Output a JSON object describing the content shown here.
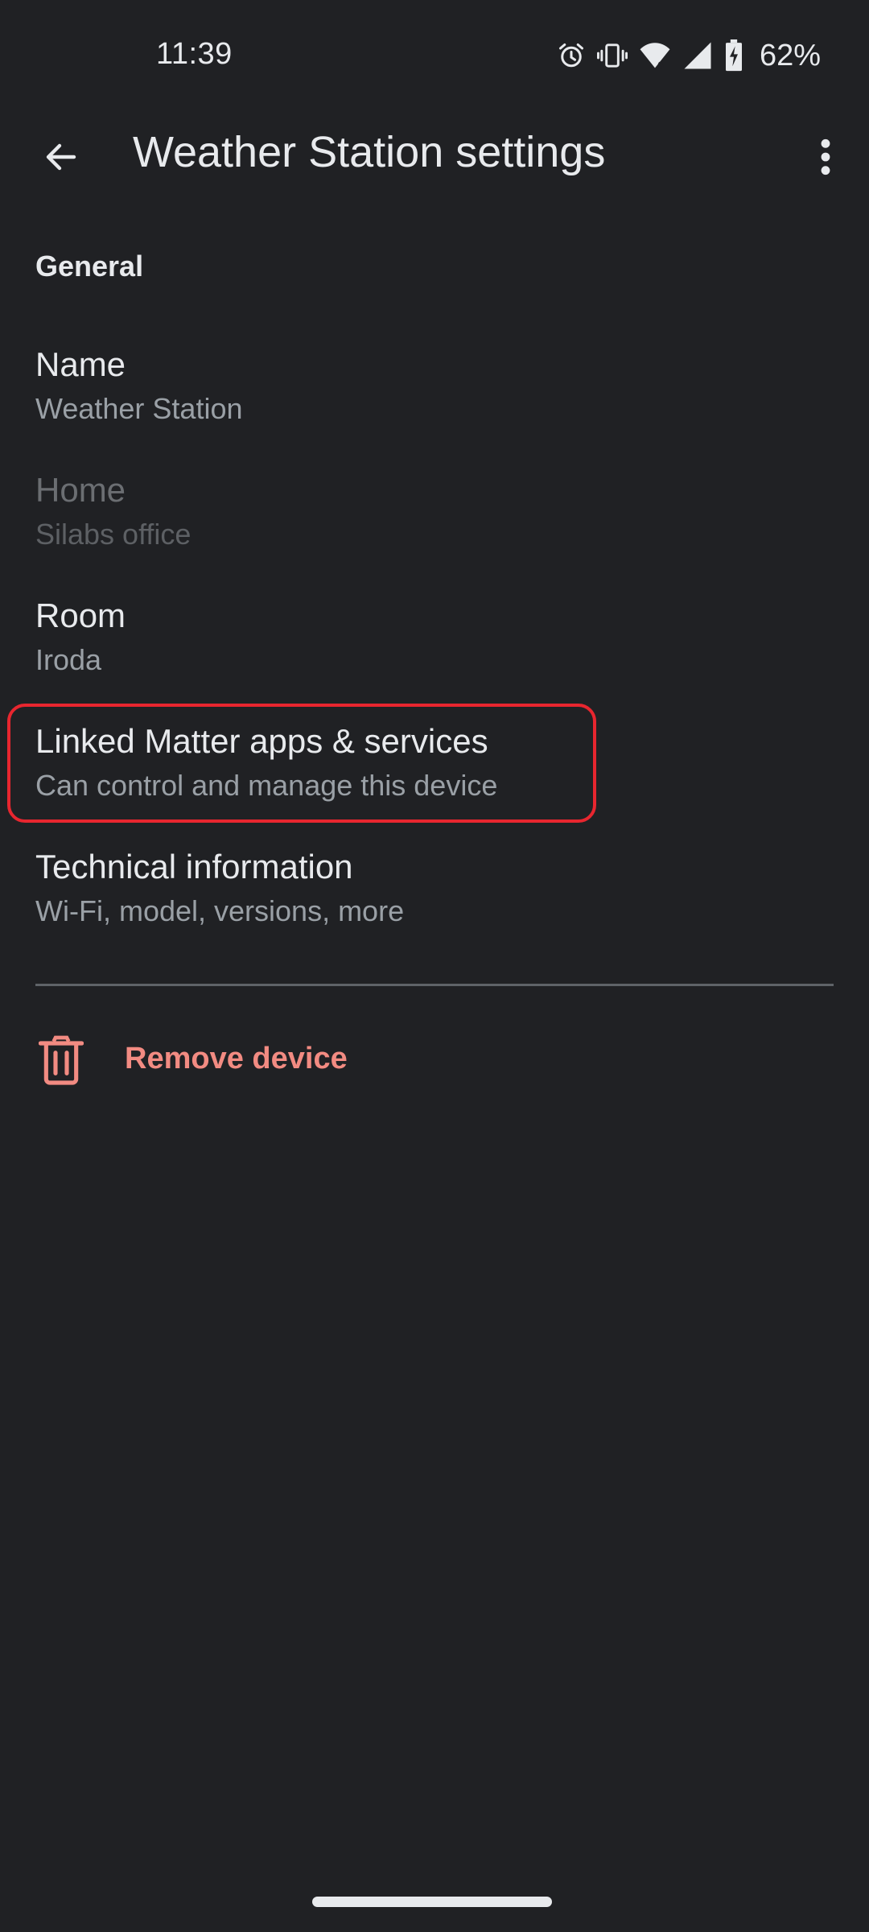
{
  "status_bar": {
    "time": "11:39",
    "battery": "62%",
    "icons": [
      "alarm-icon",
      "vibrate-icon",
      "wifi-6-icon",
      "cell-signal-icon",
      "battery-charging-icon"
    ]
  },
  "app_bar": {
    "title": "Weather Station settings",
    "back_icon": "arrow-back-icon",
    "overflow_icon": "more-vert-icon"
  },
  "section": {
    "general": "General"
  },
  "settings": {
    "name": {
      "title": "Name",
      "value": "Weather Station"
    },
    "home": {
      "title": "Home",
      "value": "Silabs office"
    },
    "room": {
      "title": "Room",
      "value": "Iroda"
    },
    "linked": {
      "title": "Linked Matter apps & services",
      "value": "Can control and manage this device"
    },
    "technical": {
      "title": "Technical information",
      "value": "Wi-Fi, model, versions, more"
    }
  },
  "remove": {
    "label": "Remove device",
    "icon": "trash-icon"
  },
  "colors": {
    "background": "#202124",
    "text_primary": "#e8eaed",
    "text_secondary": "#9aa0a6",
    "danger": "#f28b82",
    "highlight": "#e8262f"
  }
}
